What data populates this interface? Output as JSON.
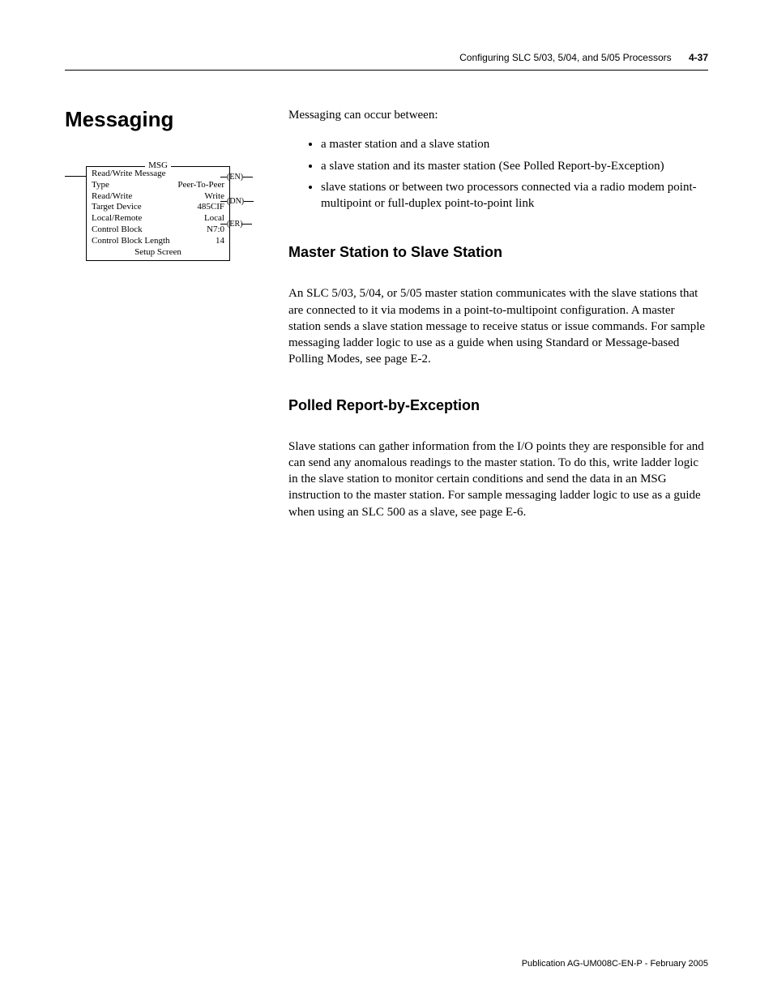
{
  "header": {
    "chapter_title": "Configuring SLC 5/03, 5/04, and 5/05 Processors",
    "page_number": "4-37"
  },
  "section_title": "Messaging",
  "intro_line": "Messaging can occur between:",
  "bullets": [
    "a master station and a slave station",
    "a slave station and its master station (See Polled Report-by-Exception)",
    "slave stations or between two processors connected via a radio modem point-multipoint or full-duplex point-to-point link"
  ],
  "sub1": {
    "heading": "Master Station to Slave Station",
    "body": "An SLC 5/03, 5/04, or 5/05 master station communicates with the slave stations that are connected to it via modems in a point-to-multipoint configuration. A master station sends a slave station message to receive status or issue commands. For sample messaging ladder logic to use as a guide when using Standard or Message-based Polling Modes, see page E-2."
  },
  "sub2": {
    "heading": "Polled Report-by-Exception",
    "body": "Slave stations can gather information from the I/O points they are responsible for and can send any anomalous readings to the master station. To do this, write ladder logic in the slave station to monitor certain conditions and send the data in an MSG instruction to the master station. For sample messaging ladder logic to use as a guide when using an SLC 500 as a slave, see page E-6."
  },
  "msg_block": {
    "title": "MSG",
    "subtitle": "Read/Write Message",
    "rows": [
      {
        "label": "Type",
        "value": "Peer-To-Peer"
      },
      {
        "label": "Read/Write",
        "value": "Write"
      },
      {
        "label": "Target Device",
        "value": "485CIF"
      },
      {
        "label": "Local/Remote",
        "value": "Local"
      },
      {
        "label": "Control Block",
        "value": "N7:0"
      },
      {
        "label": "Control Block Length",
        "value": "14"
      }
    ],
    "setup": "Setup Screen",
    "status": {
      "en": "EN",
      "dn": "DN",
      "er": "ER"
    }
  },
  "footer": "Publication AG-UM008C-EN-P - February 2005"
}
